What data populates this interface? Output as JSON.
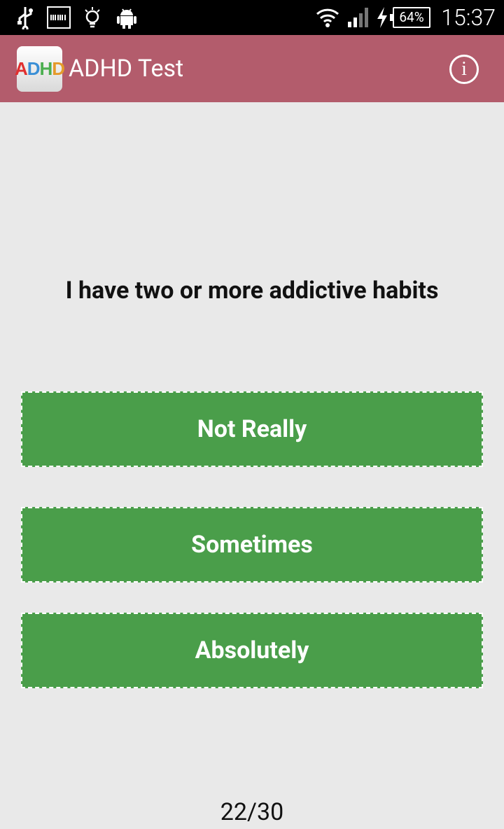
{
  "status_bar": {
    "icons": [
      "usb-icon",
      "barcode-icon",
      "lightbulb-icon",
      "android-icon",
      "wifi-icon",
      "signal-icon",
      "charging-icon"
    ],
    "battery": "64%",
    "time": "15:37"
  },
  "app_bar": {
    "logo_letters": [
      "A",
      "D",
      "H",
      "D"
    ],
    "logo_colors": [
      "#e03030",
      "#3a8fd6",
      "#4caf50",
      "#e59a2b"
    ],
    "title": "ADHD Test",
    "info_symbol": "i"
  },
  "question": "I have two or more addictive habits",
  "answers": [
    "Not Really",
    "Sometimes",
    "Absolutely"
  ],
  "progress": "22/30",
  "colors": {
    "app_bar": "#b35c6c",
    "answer_button": "#4a9e4a",
    "background": "#e9e9e9"
  }
}
